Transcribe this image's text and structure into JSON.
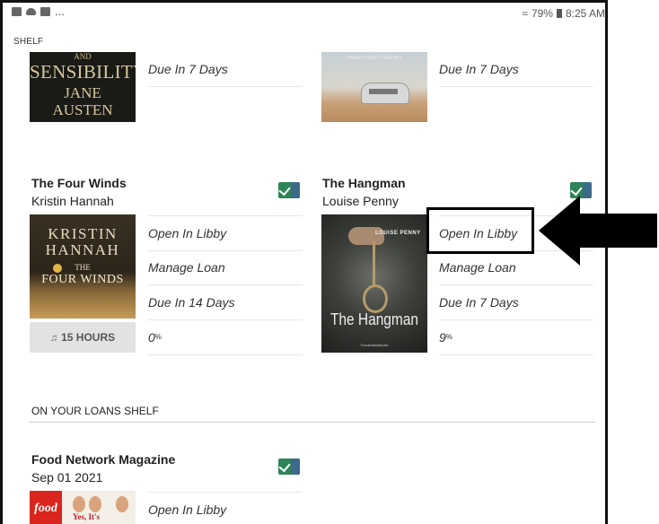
{
  "status_bar": {
    "left_dots": "...",
    "signal": "≈",
    "battery_pct": "79%",
    "time": "8:25 AM"
  },
  "shelf_label": "SHELF",
  "book1": {
    "cover": {
      "and": "AND",
      "title": "SENSIBILITY",
      "author_line1": "JANE",
      "author_line2": "AUSTEN"
    },
    "due": "Due In 7 Days"
  },
  "book2": {
    "cover": {
      "caption": "TWENTY-FIRST CENTURY"
    },
    "due": "Due In 7 Days"
  },
  "book3": {
    "title": "The Four Winds",
    "author": "Kristin Hannah",
    "cover": {
      "line1": "KRISTIN",
      "line2": "HANNAH",
      "the": "THE",
      "title": "FOUR WINDS"
    },
    "open": "Open In Libby",
    "manage": "Manage Loan",
    "due": "Due In 14 Days",
    "progress": "0",
    "progress_unit": "%",
    "hours": "15 HOURS"
  },
  "book4": {
    "title": "The Hangman",
    "author": "Louise Penny",
    "cover": {
      "author": "LOUISE PENNY",
      "title": "The Hangman",
      "publisher": "GoodreadsBooks"
    },
    "open": "Open In Libby",
    "manage": "Manage Loan",
    "due": "Due In 7 Days",
    "progress": "9",
    "progress_unit": "%"
  },
  "loans_section": "ON YOUR LOANS SHELF",
  "magazine": {
    "title": "Food Network Magazine",
    "date": "Sep 01 2021",
    "cover": {
      "logo": "food",
      "headline": "Yes, It's"
    },
    "open": "Open In Libby"
  }
}
